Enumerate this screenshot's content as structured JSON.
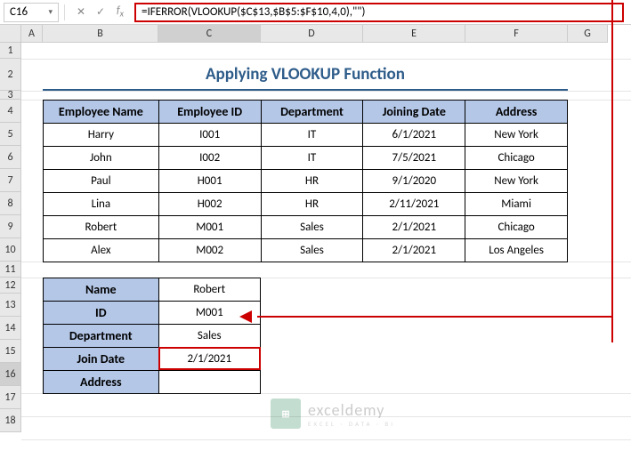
{
  "name_box": "C16",
  "formula": "=IFERROR(VLOOKUP($C$13,$B$5:$F$10,4,0),\"\")",
  "title": "Applying VLOOKUP Function",
  "columns": [
    "A",
    "B",
    "C",
    "D",
    "E",
    "F",
    "G"
  ],
  "rows": [
    "1",
    "2",
    "3",
    "4",
    "5",
    "6",
    "7",
    "8",
    "9",
    "10",
    "11",
    "12",
    "13",
    "14",
    "15",
    "16",
    "17",
    "18"
  ],
  "headers": {
    "name": "Employee Name",
    "id": "Employee ID",
    "dept": "Department",
    "join": "Joining Date",
    "addr": "Address"
  },
  "data": [
    {
      "name": "Harry",
      "id": "I001",
      "dept": "IT",
      "join": "6/1/2021",
      "addr": "New York"
    },
    {
      "name": "John",
      "id": "I002",
      "dept": "IT",
      "join": "7/5/2021",
      "addr": "Chicago"
    },
    {
      "name": "Paul",
      "id": "H001",
      "dept": "HR",
      "join": "9/1/2020",
      "addr": "New York"
    },
    {
      "name": "Lina",
      "id": "H002",
      "dept": "HR",
      "join": "2/11/2021",
      "addr": "Miami"
    },
    {
      "name": "Robert",
      "id": "M001",
      "dept": "Sales",
      "join": "2/1/2021",
      "addr": "Chicago"
    },
    {
      "name": "Alex",
      "id": "M002",
      "dept": "Sales",
      "join": "2/1/2021",
      "addr": "Los Angeles"
    }
  ],
  "lookup": {
    "labels": {
      "name": "Name",
      "id": "ID",
      "dept": "Department",
      "join": "Join Date",
      "addr": "Address"
    },
    "values": {
      "name": "Robert",
      "id": "M001",
      "dept": "Sales",
      "join": "2/1/2021",
      "addr": ""
    }
  },
  "watermark": {
    "main": "exceldemy",
    "sub": "EXCEL · DATA · BI"
  }
}
